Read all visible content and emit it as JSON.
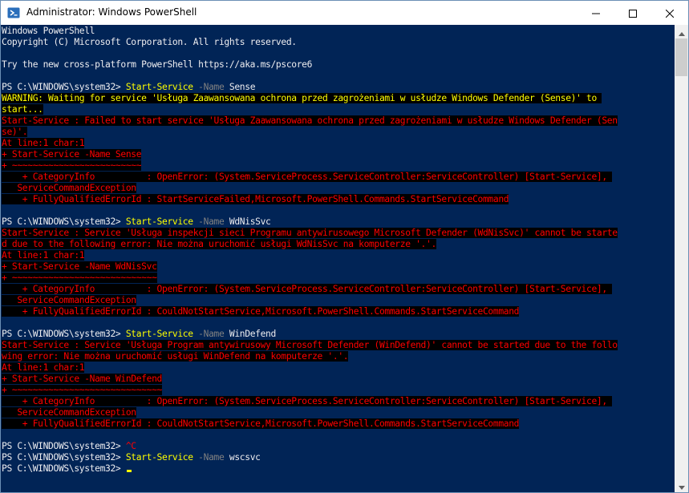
{
  "window": {
    "title": "Administrator: Windows PowerShell",
    "icon": "powershell-icon",
    "controls": [
      "minimize-icon",
      "maximize-icon",
      "close-icon"
    ]
  },
  "colors": {
    "console_background": "#012456",
    "foreground": "#EEEDF0",
    "error_foreground": "#FF0000",
    "error_background": "#000000",
    "warning_foreground": "#FFFF00",
    "command": "#FFFF00",
    "parameter": "#808080",
    "titlebar": "#FFFFFF"
  },
  "console": {
    "lines": [
      [
        {
          "t": "Windows PowerShell",
          "c": "normal"
        }
      ],
      [
        {
          "t": "Copyright (C) Microsoft Corporation. All rights reserved.",
          "c": "normal"
        }
      ],
      [
        {
          "t": "",
          "c": "normal"
        }
      ],
      [
        {
          "t": "Try the new cross-platform PowerShell https://aka.ms/pscore6",
          "c": "normal"
        }
      ],
      [
        {
          "t": "",
          "c": "normal"
        }
      ],
      [
        {
          "t": "PS C:\\WINDOWS\\system32> ",
          "c": "normal"
        },
        {
          "t": "Start-Service",
          "c": "cmd"
        },
        {
          "t": " -Name",
          "c": "param"
        },
        {
          "t": " Sense",
          "c": "normal"
        }
      ],
      [
        {
          "t": "WARNING: Waiting for service 'Usługa Zaawansowana ochrona przed zagrożeniami w usłudze Windows Defender (Sense)' to ",
          "c": "warn"
        }
      ],
      [
        {
          "t": "start...",
          "c": "warn"
        }
      ],
      [
        {
          "t": "Start-Service : Failed to start service 'Usługa Zaawansowana ochrona przed zagrożeniami w usłudze Windows Defender (Sen",
          "c": "err"
        }
      ],
      [
        {
          "t": "se)'.",
          "c": "err"
        }
      ],
      [
        {
          "t": "At line:1 char:1",
          "c": "err"
        }
      ],
      [
        {
          "t": "+ Start-Service -Name Sense",
          "c": "err"
        }
      ],
      [
        {
          "t": "+ ~~~~~~~~~~~~~~~~~~~~~~~~~",
          "c": "err"
        }
      ],
      [
        {
          "t": "    + CategoryInfo          : OpenError: (System.ServiceProcess.ServiceController:ServiceController) [Start-Service], ",
          "c": "err"
        }
      ],
      [
        {
          "t": "   ServiceCommandException",
          "c": "err"
        }
      ],
      [
        {
          "t": "    + FullyQualifiedErrorId : StartServiceFailed,Microsoft.PowerShell.Commands.StartServiceCommand",
          "c": "err"
        }
      ],
      [
        {
          "t": "",
          "c": "normal"
        }
      ],
      [
        {
          "t": "PS C:\\WINDOWS\\system32> ",
          "c": "normal"
        },
        {
          "t": "Start-Service",
          "c": "cmd"
        },
        {
          "t": " -Name",
          "c": "param"
        },
        {
          "t": " WdNisSvc",
          "c": "normal"
        }
      ],
      [
        {
          "t": "Start-Service : Service 'Usługa inspekcji sieci Programu antywirusowego Microsoft Defender (WdNisSvc)' cannot be starte",
          "c": "err"
        }
      ],
      [
        {
          "t": "d due to the following error: Nie można uruchomić usługi WdNisSvc na komputerze '.'.",
          "c": "err"
        }
      ],
      [
        {
          "t": "At line:1 char:1",
          "c": "err"
        }
      ],
      [
        {
          "t": "+ Start-Service -Name WdNisSvc",
          "c": "err"
        }
      ],
      [
        {
          "t": "+ ~~~~~~~~~~~~~~~~~~~~~~~~~~~~",
          "c": "err"
        }
      ],
      [
        {
          "t": "    + CategoryInfo          : OpenError: (System.ServiceProcess.ServiceController:ServiceController) [Start-Service], ",
          "c": "err"
        }
      ],
      [
        {
          "t": "   ServiceCommandException",
          "c": "err"
        }
      ],
      [
        {
          "t": "    + FullyQualifiedErrorId : CouldNotStartService,Microsoft.PowerShell.Commands.StartServiceCommand",
          "c": "err"
        }
      ],
      [
        {
          "t": "",
          "c": "normal"
        }
      ],
      [
        {
          "t": "PS C:\\WINDOWS\\system32> ",
          "c": "normal"
        },
        {
          "t": "Start-Service",
          "c": "cmd"
        },
        {
          "t": " -Name",
          "c": "param"
        },
        {
          "t": " WinDefend",
          "c": "normal"
        }
      ],
      [
        {
          "t": "Start-Service : Service 'Usługa Program antywirusowy Microsoft Defender (WinDefend)' cannot be started due to the follo",
          "c": "err"
        }
      ],
      [
        {
          "t": "wing error: Nie można uruchomić usługi WinDefend na komputerze '.'.",
          "c": "err"
        }
      ],
      [
        {
          "t": "At line:1 char:1",
          "c": "err"
        }
      ],
      [
        {
          "t": "+ Start-Service -Name WinDefend",
          "c": "err"
        }
      ],
      [
        {
          "t": "+ ~~~~~~~~~~~~~~~~~~~~~~~~~~~~~",
          "c": "err"
        }
      ],
      [
        {
          "t": "    + CategoryInfo          : OpenError: (System.ServiceProcess.ServiceController:ServiceController) [Start-Service], ",
          "c": "err"
        }
      ],
      [
        {
          "t": "   ServiceCommandException",
          "c": "err"
        }
      ],
      [
        {
          "t": "    + FullyQualifiedErrorId : CouldNotStartService,Microsoft.PowerShell.Commands.StartServiceCommand",
          "c": "err"
        }
      ],
      [
        {
          "t": "",
          "c": "normal"
        }
      ],
      [
        {
          "t": "PS C:\\WINDOWS\\system32> ",
          "c": "normal"
        },
        {
          "t": "^C",
          "c": "ctrl"
        }
      ],
      [
        {
          "t": "PS C:\\WINDOWS\\system32> ",
          "c": "normal"
        },
        {
          "t": "Start-Service",
          "c": "cmd"
        },
        {
          "t": " -Name",
          "c": "param"
        },
        {
          "t": " wscsvc",
          "c": "normal"
        }
      ],
      [
        {
          "t": "PS C:\\WINDOWS\\system32> ",
          "c": "normal"
        }
      ]
    ]
  },
  "scrollbar": {
    "up_icon": "scroll-up-arrow-icon",
    "down_icon": "scroll-down-arrow-icon"
  }
}
